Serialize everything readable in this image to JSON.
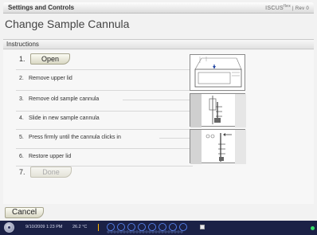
{
  "header": {
    "title": "Settings and Controls",
    "brand": "ISCUS",
    "brand_sup": "flex",
    "revision": "Rev 0"
  },
  "page": {
    "title": "Change Sample Cannula",
    "section": "Instructions"
  },
  "steps": [
    {
      "num": "1.",
      "button": "Open"
    },
    {
      "num": "2.",
      "label": "Remove upper lid"
    },
    {
      "num": "3.",
      "label": "Remove old sample cannula"
    },
    {
      "num": "4.",
      "label": "Slide in new sample cannula"
    },
    {
      "num": "5.",
      "label": "Press firmly until the cannula clicks in"
    },
    {
      "num": "6.",
      "label": "Restore upper lid"
    },
    {
      "num": "7.",
      "button": "Done"
    }
  ],
  "footer": {
    "cancel_label": "Cancel"
  },
  "status": {
    "datetime": "9/10/2009 1:23 PM",
    "temperature": "26.2 °C",
    "accent_color": "#ffb400",
    "background_color": "#1b2146",
    "led_color": "#35e06a"
  }
}
